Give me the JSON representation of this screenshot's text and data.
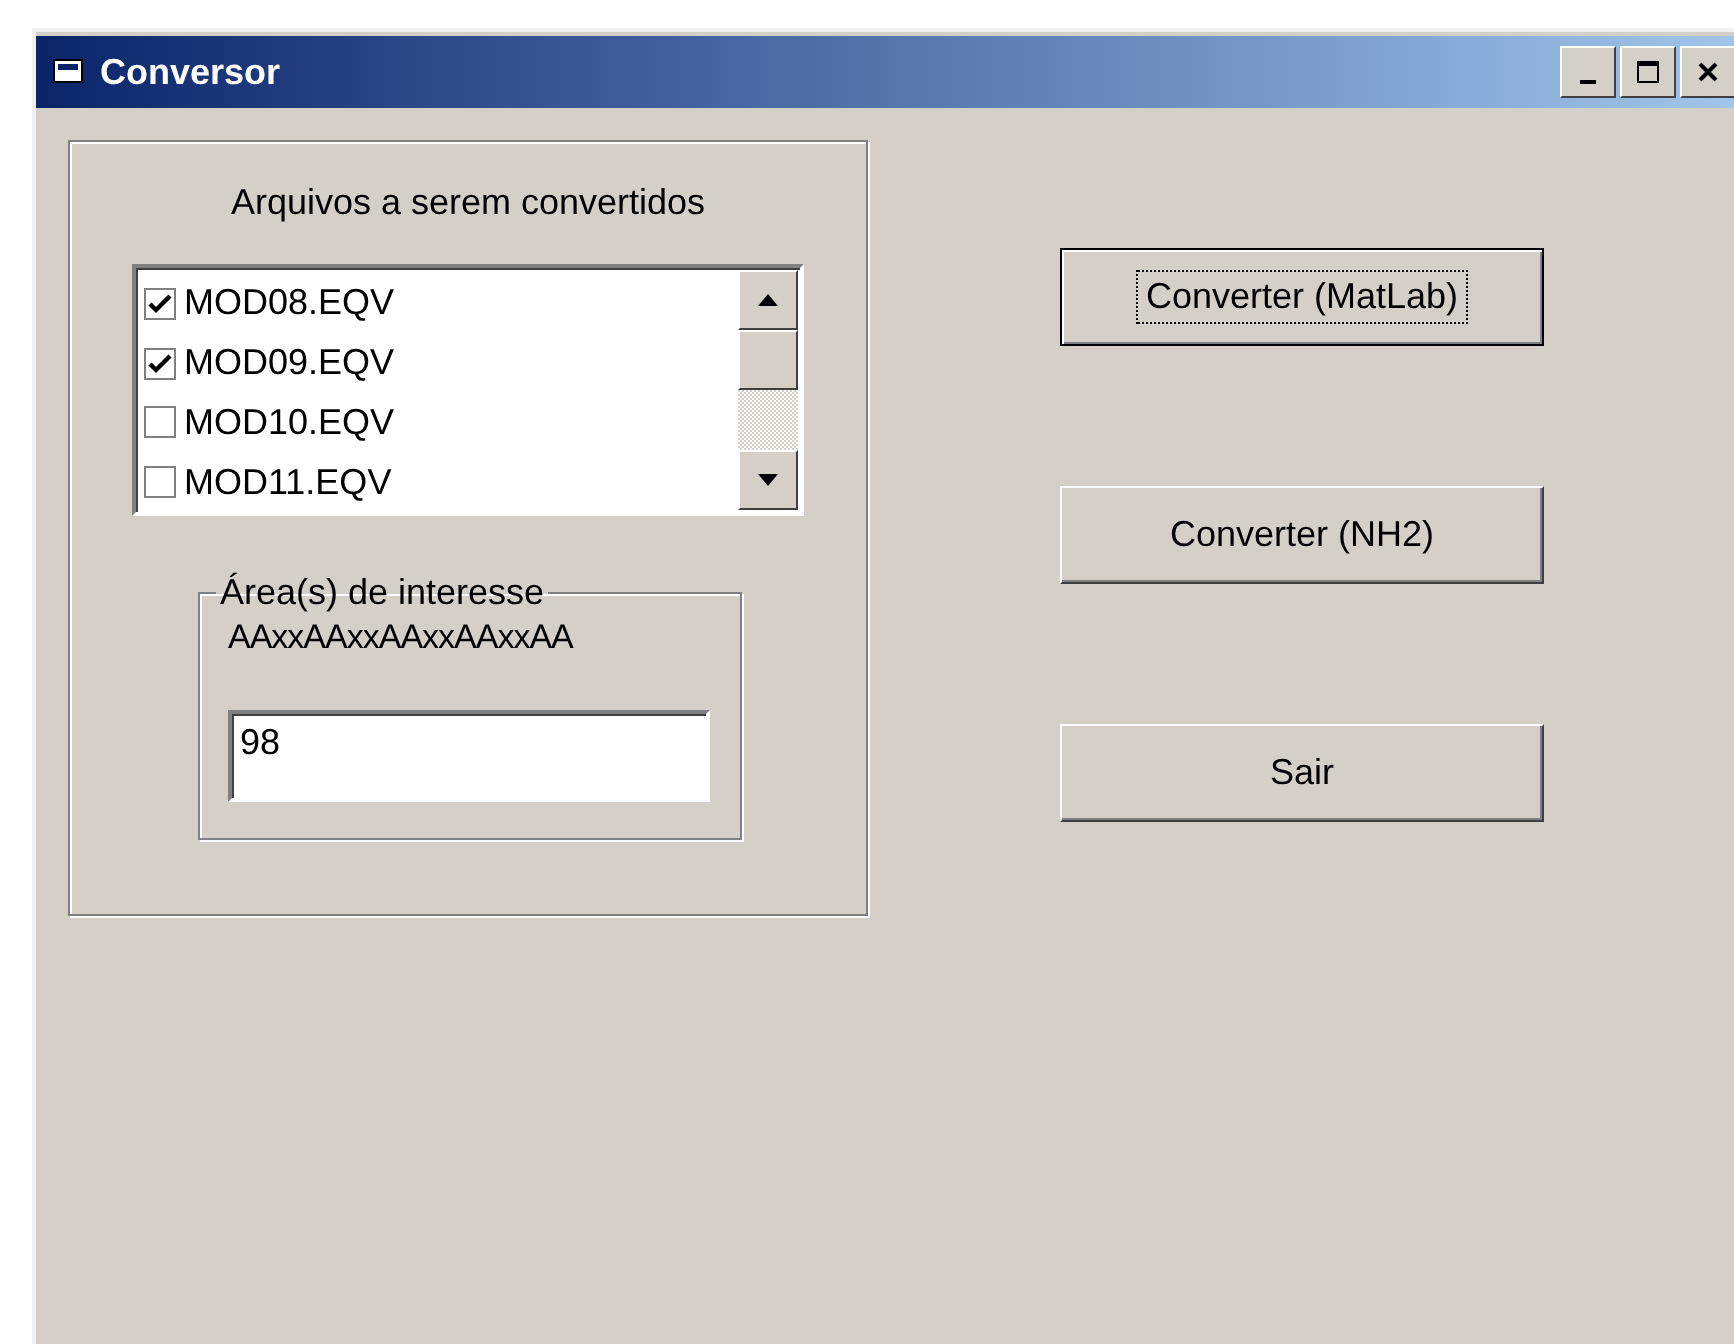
{
  "window": {
    "title": "Conversor"
  },
  "files_group": {
    "title": "Arquivos a serem convertidos",
    "items": [
      {
        "label": "MOD08.EQV",
        "checked": true
      },
      {
        "label": "MOD09.EQV",
        "checked": true
      },
      {
        "label": "MOD10.EQV",
        "checked": false
      },
      {
        "label": "MOD11.EQV",
        "checked": false
      }
    ]
  },
  "interest_group": {
    "legend": "Área(s) de interesse",
    "format": "AAxxAAxxAAxxAAxxAA",
    "value": "98"
  },
  "buttons": [
    {
      "label": "Converter (MatLab)",
      "focused": true
    },
    {
      "label": "Converter (NH2)",
      "focused": false
    },
    {
      "label": "Sair",
      "focused": false
    }
  ]
}
